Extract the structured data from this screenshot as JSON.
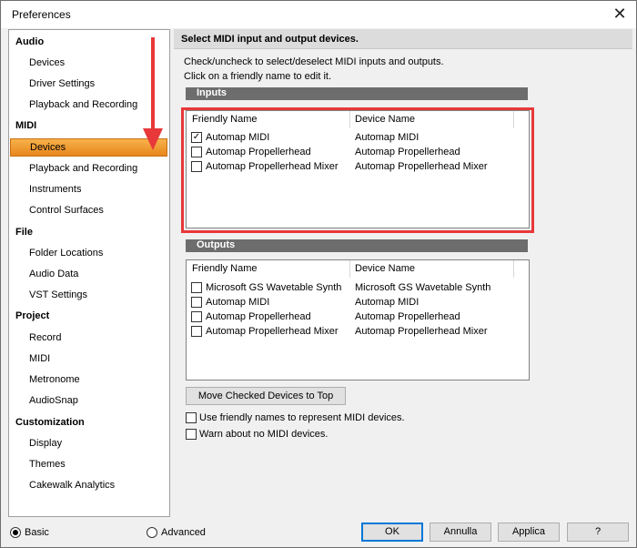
{
  "window": {
    "title": "Preferences",
    "close": "✕"
  },
  "sidebar": {
    "categories": [
      {
        "label": "Audio",
        "items": [
          "Devices",
          "Driver Settings",
          "Playback and Recording"
        ]
      },
      {
        "label": "MIDI",
        "items": [
          "Devices",
          "Playback and Recording",
          "Instruments",
          "Control Surfaces"
        ]
      },
      {
        "label": "File",
        "items": [
          "Folder Locations",
          "Audio Data",
          "VST Settings"
        ]
      },
      {
        "label": "Project",
        "items": [
          "Record",
          "MIDI",
          "Metronome",
          "AudioSnap"
        ]
      },
      {
        "label": "Customization",
        "items": [
          "Display",
          "Themes",
          "Cakewalk Analytics"
        ]
      }
    ],
    "selected_label": "Devices"
  },
  "main": {
    "header": "Select MIDI input and output devices.",
    "instruction1": "Check/uncheck to select/deselect MIDI inputs and outputs.",
    "instruction2": "Click on a friendly name to edit it.",
    "inputs": {
      "section_label": "Inputs",
      "col_friendly": "Friendly Name",
      "col_device": "Device Name",
      "rows": [
        {
          "name": "Automap MIDI",
          "device": "Automap MIDI",
          "checked": true
        },
        {
          "name": "Automap Propellerhead",
          "device": "Automap Propellerhead",
          "checked": false
        },
        {
          "name": "Automap Propellerhead Mixer",
          "device": "Automap Propellerhead Mixer",
          "checked": false
        }
      ]
    },
    "outputs": {
      "section_label": "Outputs",
      "col_friendly": "Friendly Name",
      "col_device": "Device Name",
      "rows": [
        {
          "name": "Microsoft GS Wavetable Synth",
          "device": "Microsoft GS Wavetable Synth",
          "checked": false
        },
        {
          "name": "Automap MIDI",
          "device": "Automap MIDI",
          "checked": false
        },
        {
          "name": "Automap Propellerhead",
          "device": "Automap Propellerhead",
          "checked": false
        },
        {
          "name": "Automap Propellerhead Mixer",
          "device": "Automap Propellerhead Mixer",
          "checked": false
        }
      ]
    },
    "move_button": "Move Checked Devices to Top",
    "option_friendly": "Use friendly names to represent MIDI devices.",
    "option_warn": "Warn about no MIDI devices."
  },
  "footer": {
    "basic": "Basic",
    "advanced": "Advanced",
    "mode_selected": "Basic",
    "ok": "OK",
    "cancel": "Annulla",
    "apply": "Applica",
    "help": "?"
  },
  "colors": {
    "selection": "#f0a030",
    "annotation": "#e8383a",
    "section_bar": "#6d6d6d"
  }
}
